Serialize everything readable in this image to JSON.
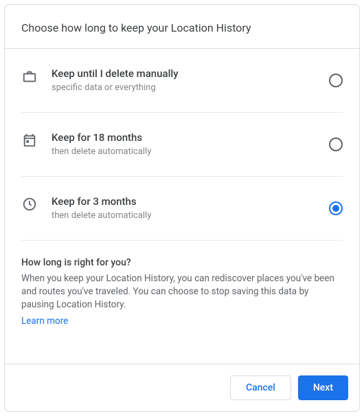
{
  "header": {
    "title": "Choose how long to keep your Location History"
  },
  "options": [
    {
      "icon": "briefcase-icon",
      "title": "Keep until I delete manually",
      "sub": "specific data or everything",
      "selected": false
    },
    {
      "icon": "calendar-icon",
      "title": "Keep for 18 months",
      "sub": "then delete automatically",
      "selected": false
    },
    {
      "icon": "clock-icon",
      "title": "Keep for 3 months",
      "sub": "then delete automatically",
      "selected": true
    }
  ],
  "info": {
    "title": "How long is right for you?",
    "body": "When you keep your Location History, you can rediscover places you've been and routes you've traveled. You can choose to stop saving this data by pausing Location History.",
    "learn_more": "Learn more"
  },
  "footer": {
    "cancel": "Cancel",
    "next": "Next"
  }
}
